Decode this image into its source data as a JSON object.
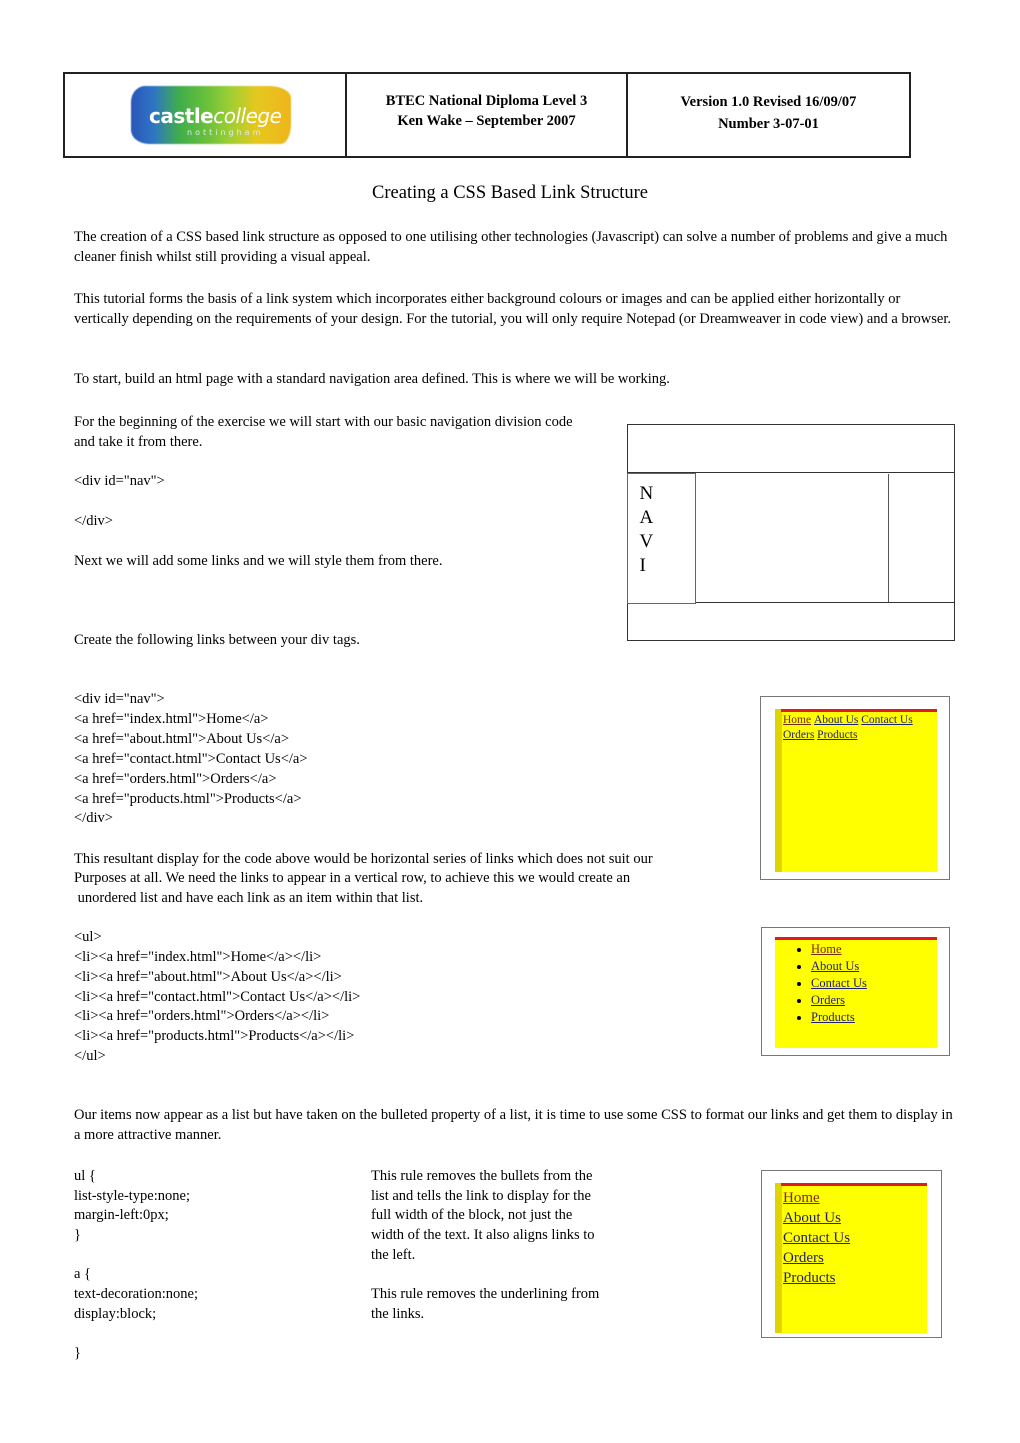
{
  "header": {
    "logo": {
      "brand_bold": "castle",
      "brand_italic": "college",
      "subtitle": "nottingham"
    },
    "course": "BTEC National Diploma Level 3",
    "author": "Ken Wake – September 2007",
    "version": "Version 1.0 Revised 16/09/07",
    "number": "Number 3-07-01"
  },
  "title": "Creating a CSS Based Link Structure",
  "intro": [
    "The creation of a CSS based link structure as opposed to one utilising other technologies (Javascript) can solve a number of problems and give a much cleaner finish whilst still providing a visual appeal.",
    "This tutorial forms the basis of a link system which incorporates either background colours or images and can be applied either horizontally or vertically depending on the requirements of your design. For the tutorial, you will only require Notepad (or Dreamweaver in code view) and a browser.",
    "To start, build an html page with a standard navigation area defined. This is where we will be working."
  ],
  "section1": {
    "para": "For the beginning of the exercise we will start with our basic navigation division code and take it from there.",
    "code_open": "<div id=\"nav\">",
    "code_close": "</div>",
    "next": "Next we will add some links and we will style them from there.",
    "create": "Create the following links between your div tags."
  },
  "diagram": {
    "nav_letters": [
      "N",
      "A",
      "V",
      "I"
    ]
  },
  "code_links": [
    "<div id=\"nav\">",
    "<a href=\"index.html\">Home</a>",
    "<a href=\"about.html\">About Us</a>",
    "<a href=\"contact.html\">Contact Us</a>",
    "<a href=\"orders.html\">Orders</a>",
    "<a href=\"products.html\">Products</a>",
    "</div>"
  ],
  "para_horizontal": [
    "This resultant display for the code above would be horizontal series of links which does not suit our",
    "Purposes at all. We need the links to appear in a vertical row, to achieve this we would create an",
    " unordered list and have each link as an item within that list."
  ],
  "code_list": [
    "<ul>",
    "<li><a href=\"index.html\">Home</a></li>",
    "<li><a href=\"about.html\">About Us</a></li>",
    "<li><a href=\"contact.html\">Contact Us</a></li>",
    "<li><a href=\"orders.html\">Orders</a></li>",
    "<li><a href=\"products.html\">Products</a></li>",
    "</ul>"
  ],
  "para_css": "Our items now appear as a list but have taken on the bulleted property of a list, it is time to use some CSS to format our links and get them to display in a more attractive manner.",
  "css_code": [
    "ul {",
    "list-style-type:none;",
    "margin-left:0px;",
    "}",
    "",
    "a {",
    "text-decoration:none;",
    "display:block;",
    "",
    "}"
  ],
  "css_notes": {
    "ul_note": [
      "This rule removes the bullets from the",
      "list and tells the link to display for the",
      "full width of the block, not just the",
      "width of the text. It also aligns links to",
      "the left."
    ],
    "a_note": [
      "This rule removes the underlining from",
      "the links."
    ]
  },
  "mock_links": [
    "Home",
    "About Us",
    "Contact Us",
    "Orders",
    "Products"
  ],
  "colors": {
    "mock_background": "#ffff00",
    "mock_top_bar": "#e21a1a",
    "link": "#22226e",
    "visited_link": "#7a2a10"
  }
}
